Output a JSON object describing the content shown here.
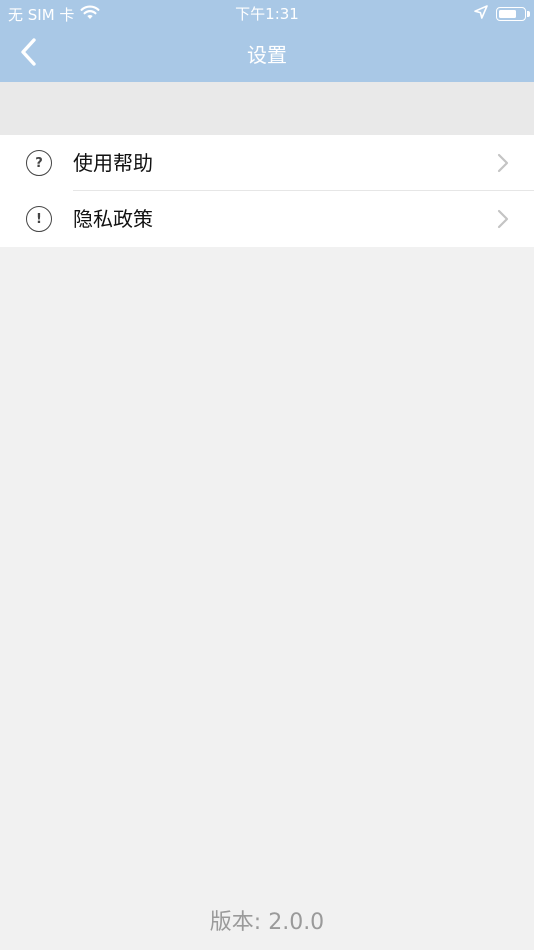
{
  "status_bar": {
    "carrier": "无 SIM 卡",
    "time": "下午1:31",
    "icons": [
      "wifi-icon",
      "location-arrow-icon",
      "battery-icon"
    ]
  },
  "nav": {
    "title": "设置",
    "back_icon": "chevron-left-icon"
  },
  "menu": {
    "items": [
      {
        "label": "使用帮助",
        "icon_glyph": "?",
        "icon": "question-circle-icon"
      },
      {
        "label": "隐私政策",
        "icon_glyph": "!",
        "icon": "exclamation-circle-icon"
      }
    ]
  },
  "footer": {
    "version": "版本: 2.0.0"
  },
  "colors": {
    "header_bg": "#a9c8e6",
    "page_bg": "#f1f1f1",
    "section_gap_bg": "#e9e9e9",
    "text": "#111111",
    "muted_text": "#9a9a9a"
  }
}
